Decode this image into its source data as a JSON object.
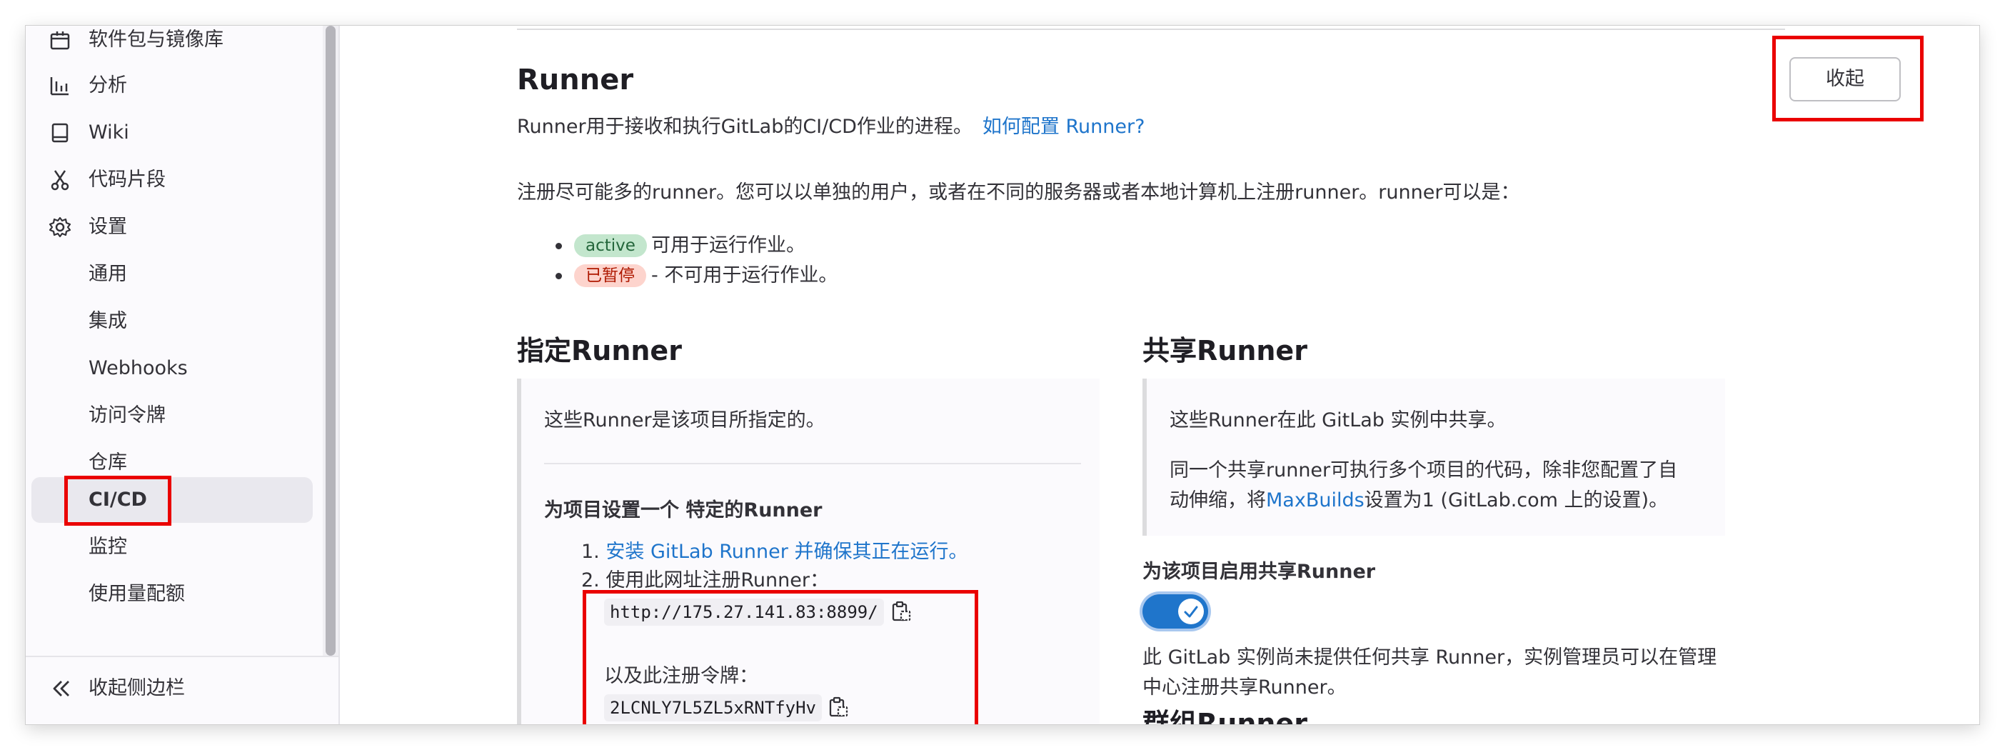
{
  "sidebar": {
    "items": [
      {
        "label": "软件包与镜像库",
        "icon": "package-icon"
      },
      {
        "label": "分析",
        "icon": "chart-icon"
      },
      {
        "label": "Wiki",
        "icon": "book-icon"
      },
      {
        "label": "代码片段",
        "icon": "snippet-icon"
      },
      {
        "label": "设置",
        "icon": "gear-icon"
      },
      {
        "label": "通用"
      },
      {
        "label": "集成"
      },
      {
        "label": "Webhooks"
      },
      {
        "label": "访问令牌"
      },
      {
        "label": "仓库"
      },
      {
        "label": "CI/CD"
      },
      {
        "label": "监控"
      },
      {
        "label": "使用量配额"
      }
    ],
    "active_item": "CI/CD",
    "collapse_label": "收起侧边栏"
  },
  "runner_section": {
    "title": "Runner",
    "description": "Runner用于接收和执行GitLab的CI/CD作业的进程。",
    "help_link": "如何配置 Runner?",
    "collapse_button": "收起",
    "register_text": "注册尽可能多的runner。您可以以单独的用户，或者在不同的服务器或者本地计算机上注册runner。runner可以是：",
    "statuses": [
      {
        "badge": "active",
        "text": "可用于运行作业。"
      },
      {
        "badge": "已暂停",
        "text": "- 不可用于运行作业。"
      }
    ]
  },
  "specific_runners": {
    "title": "指定Runner",
    "intro": "这些Runner是该项目所指定的。",
    "setup_title": "为项目设置一个 特定的Runner",
    "step1_num": "1.",
    "step1_link": "安装 GitLab Runner 并确保其正在运行。",
    "step2_num": "2.",
    "step2_text": "使用此网址注册Runner：",
    "url": "http://175.27.141.83:8899/",
    "token_label": "以及此注册令牌：",
    "token": "2LCNLY7L5ZL5xRNTfyHv"
  },
  "shared_runners": {
    "title": "共享Runner",
    "intro": "这些Runner在此 GitLab 实例中共享。",
    "desc_line1": "同一个共享runner可执行多个项目的代码，除非您配置了自",
    "desc_line2_pre": "动伸缩，将",
    "desc_link": "MaxBuilds",
    "desc_line2_post": "设置为1 (GitLab.com 上的设置)。",
    "enable_label": "为该项目启用共享Runner",
    "toggle_on": true,
    "note_line1": "此 GitLab 实例尚未提供任何共享 Runner，实例管理员可以在管理",
    "note_line2": "中心注册共享Runner。"
  },
  "group_runners": {
    "title": "群组Runner"
  },
  "colors": {
    "accent": "#1f75cb",
    "highlight_box": "#ea0000",
    "active_badge_bg": "#c3e6cd",
    "paused_badge_bg": "#fdd4cd"
  }
}
